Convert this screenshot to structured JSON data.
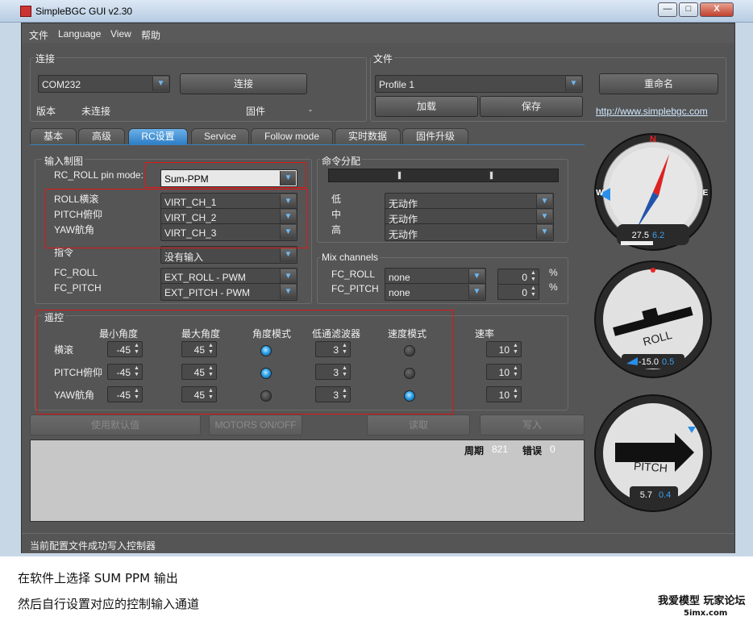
{
  "window": {
    "title": "SimpleBGC GUI v2.30",
    "min": "—",
    "max": "□",
    "close": "X"
  },
  "menu": [
    "文件",
    "Language",
    "View",
    "帮助"
  ],
  "connection": {
    "title": "连接",
    "port": "COM232",
    "connect_label": "连接",
    "version_label": "版本",
    "version_value": "未连接",
    "firmware_label": "固件",
    "firmware_value": "-"
  },
  "file": {
    "title": "文件",
    "profile": "Profile 1",
    "rename_label": "重命名",
    "load_label": "加载",
    "save_label": "保存",
    "link": "http://www.simplebgc.com"
  },
  "tabs": [
    "基本",
    "高级",
    "RC设置",
    "Service",
    "Follow mode",
    "实时数据",
    "固件升级"
  ],
  "input_map": {
    "title": "输入制图",
    "pin_mode_label": "RC_ROLL pin mode:",
    "pin_mode_value": "Sum-PPM",
    "rows": [
      {
        "label": "ROLL横滚",
        "value": "VIRT_CH_1"
      },
      {
        "label": "PITCH俯仰",
        "value": "VIRT_CH_2"
      },
      {
        "label": "YAW航角",
        "value": "VIRT_CH_3"
      },
      {
        "label": "指令",
        "value": "没有输入"
      },
      {
        "label": "FC_ROLL",
        "value": "EXT_ROLL - PWM"
      },
      {
        "label": "FC_PITCH",
        "value": "EXT_PITCH - PWM"
      }
    ]
  },
  "cmd_assign": {
    "title": "命令分配",
    "rows": [
      {
        "label": "低",
        "value": "无动作"
      },
      {
        "label": "中",
        "value": "无动作"
      },
      {
        "label": "高",
        "value": "无动作"
      }
    ]
  },
  "mix": {
    "title": "Mix channels",
    "rows": [
      {
        "label": "FC_ROLL",
        "value": "none",
        "num": "0",
        "unit": "%"
      },
      {
        "label": "FC_PITCH",
        "value": "none",
        "num": "0",
        "unit": "%"
      }
    ]
  },
  "remote": {
    "title": "遥控",
    "headers": [
      "最小角度",
      "最大角度",
      "角度模式",
      "低通滤波器",
      "速度模式",
      "速率"
    ],
    "rows": [
      {
        "label": "横滚",
        "min": "-45",
        "max": "45",
        "angle_mode": true,
        "lpf": "3",
        "speed_mode": false,
        "rate": "10"
      },
      {
        "label": "PITCH俯仰",
        "min": "-45",
        "max": "45",
        "angle_mode": true,
        "lpf": "3",
        "speed_mode": false,
        "rate": "10"
      },
      {
        "label": "YAW航角",
        "min": "-45",
        "max": "45",
        "angle_mode": false,
        "lpf": "3",
        "speed_mode": true,
        "rate": "10"
      }
    ]
  },
  "actions": {
    "defaults": "使用默认值",
    "motors": "MOTORS ON/OFF",
    "read": "读取",
    "write": "写入"
  },
  "log": {
    "cycle_label": "周期",
    "cycle_value": "821",
    "error_label": "错误",
    "error_value": "0"
  },
  "statusbar": "当前配置文件成功写入控制器",
  "gauges": {
    "yaw": {
      "north": "N",
      "east": "E",
      "west": "W",
      "value": "27.5",
      "rate": "6.2"
    },
    "roll": {
      "label": "ROLL",
      "value": "-15.0",
      "rate": "0.5"
    },
    "pitch": {
      "label": "PITCH",
      "value": "5.7",
      "rate": "0.4"
    }
  },
  "captions": [
    "在软件上选择 SUM PPM 输出",
    "然后自行设置对应的控制输入通道"
  ],
  "watermark": {
    "brand": "我爱模型 玩家论坛",
    "site": "5imx.com"
  },
  "colors": {
    "accent": "#2f7fc6",
    "panel": "#555555",
    "highlight": "#e01515"
  }
}
